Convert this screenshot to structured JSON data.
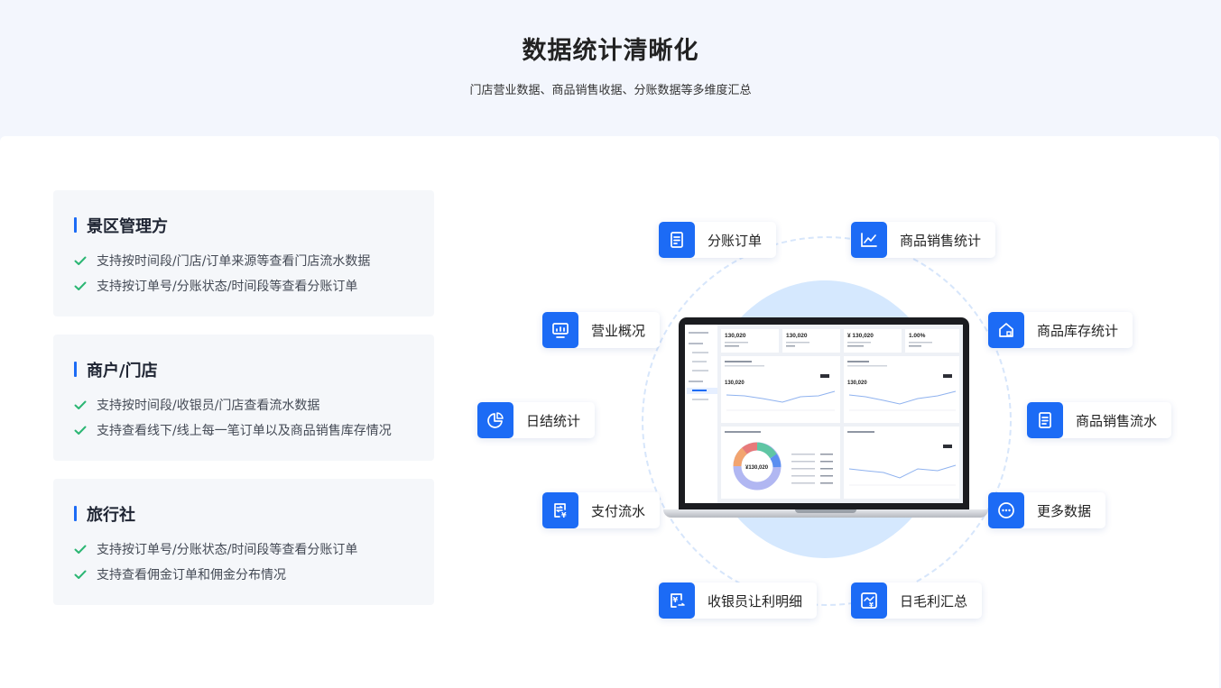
{
  "header": {
    "title": "数据统计清晰化",
    "subtitle": "门店营业数据、商品销售收据、分账数据等多维度汇总"
  },
  "roles": [
    {
      "title": "景区管理方",
      "items": [
        "支持按时间段/门店/订单来源等查看门店流水数据",
        "支持按订单号/分账状态/时间段等查看分账订单"
      ]
    },
    {
      "title": "商户/门店",
      "items": [
        "支持按时间段/收银员/门店查看流水数据",
        "支持查看线下/线上每一笔订单以及商品销售库存情况"
      ]
    },
    {
      "title": "旅行社",
      "items": [
        "支持按订单号/分账状态/时间段等查看分账订单",
        "支持查看佣金订单和佣金分布情况"
      ]
    }
  ],
  "features": {
    "split_orders": "分账订单",
    "sales_stats": "商品销售统计",
    "business_overview": "营业概况",
    "inventory_stats": "商品库存统计",
    "daily_stats": "日结统计",
    "sales_flow": "商品销售流水",
    "payment_flow": "支付流水",
    "more_data": "更多数据",
    "cashier_discount": "收银员让利明细",
    "daily_margin": "日毛利汇总"
  },
  "dashboard": {
    "kpi": [
      "130,020",
      "130,020",
      "¥ 130,020",
      "1.00%"
    ],
    "panel_value": "130,020",
    "donut_value": "¥130,020"
  },
  "colors": {
    "accent": "#1c6bf5",
    "check": "#2bb673",
    "header_bg": "#f3f6fd"
  }
}
